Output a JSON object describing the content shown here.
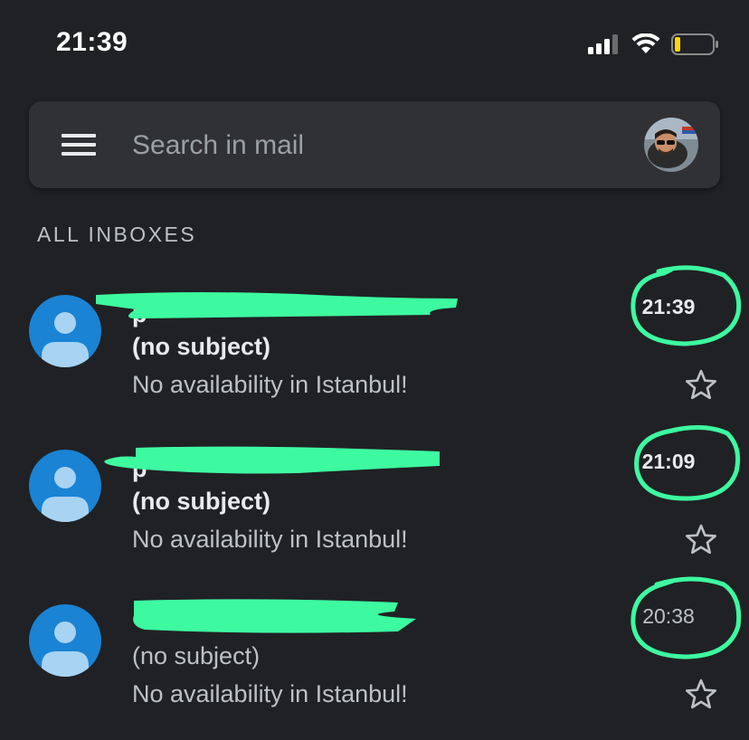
{
  "status_bar": {
    "time": "21:39",
    "icons": [
      "cellular-signal-icon",
      "wifi-icon",
      "battery-low-icon"
    ]
  },
  "search": {
    "placeholder": "Search in mail",
    "value": ""
  },
  "section": {
    "label": "ALL INBOXES"
  },
  "messages": [
    {
      "sender": "p",
      "subject": "(no subject)",
      "snippet": "No availability in Istanbul!",
      "time": "21:39",
      "unread": true,
      "starred": false
    },
    {
      "sender": "p",
      "subject": "(no subject)",
      "snippet": "No availability in Istanbul!",
      "time": "21:09",
      "unread": true,
      "starred": false
    },
    {
      "sender": "",
      "subject": "(no subject)",
      "snippet": "No availability in Istanbul!",
      "time": "20:38",
      "unread": false,
      "starred": false
    }
  ],
  "colors": {
    "background": "#202124",
    "search_bar": "#303134",
    "avatar_blue": "#1a83d4",
    "highlight_marker": "#3dfaa0",
    "battery_low": "#ffd60a"
  }
}
